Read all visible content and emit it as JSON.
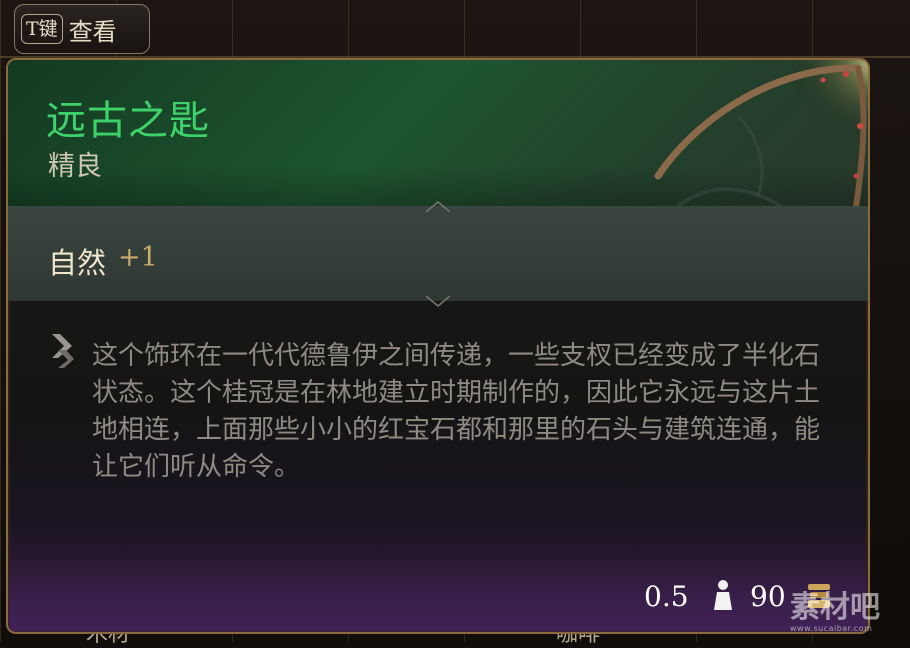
{
  "hint": {
    "key": "T键",
    "label": "查看"
  },
  "item": {
    "name": "远古之匙",
    "rarity": "精良",
    "stat_name": "自然",
    "stat_value": "+1",
    "description": "这个饰环在一代代德鲁伊之间传递，一些支杈已经变成了半化石状态。这个桂冠是在林地建立时期制作的，因此它永远与这片土地相连，上面那些小小的红宝石都和那里的石头与建筑连通，能让它们听从命令。",
    "weight": "0.5",
    "price": "90"
  },
  "watermark": {
    "main": "素材吧",
    "sub": "www.sucaibar.com"
  },
  "background": {
    "left_text": "木材",
    "right_text": "咖啡"
  },
  "colors": {
    "name": "#3ed26a",
    "stat_value": "#c9ab6a",
    "border": "#8a6a3e"
  }
}
